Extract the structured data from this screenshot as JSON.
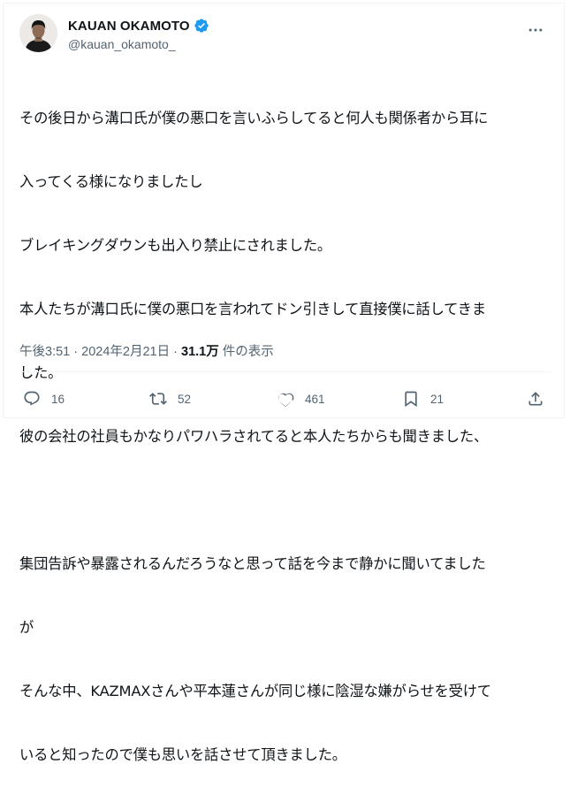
{
  "author": {
    "display_name": "KAUAN OKAMOTO",
    "handle": "@kauan_okamoto_",
    "verified_icon": "verified-badge-icon",
    "more_icon": "more-options-icon"
  },
  "post": {
    "lines": [
      "その後日から溝口氏が僕の悪口を言いふらしてると何人も関係者から耳に",
      "入ってくる様になりましたし",
      "ブレイキングダウンも出入り禁止にされました。",
      "本人たちが溝口氏に僕の悪口を言われてドン引きして直接僕に話してきま",
      "した。",
      "彼の会社の社員もかなりパワハラされてると本人たちからも聞きました、",
      "",
      "集団告訴や暴露されるんだろうなと思って話を今まで静かに聞いてました",
      "が",
      "そんな中、KAZMAXさんや平本蓮さんが同じ様に陰湿な嫌がらせを受けて",
      "いると知ったので僕も思いを話させて頂きました。"
    ],
    "time": "午後3:51",
    "separator": "·",
    "date": "2024年2月21日",
    "views_count": "31.1万",
    "views_label": "件の表示"
  },
  "actions": {
    "replies": "16",
    "reposts": "52",
    "likes": "461",
    "bookmarks": "21"
  },
  "colors": {
    "text": "#0f1419",
    "secondary": "#536471",
    "verified": "#1d9bf0",
    "border": "#eff3f4"
  }
}
